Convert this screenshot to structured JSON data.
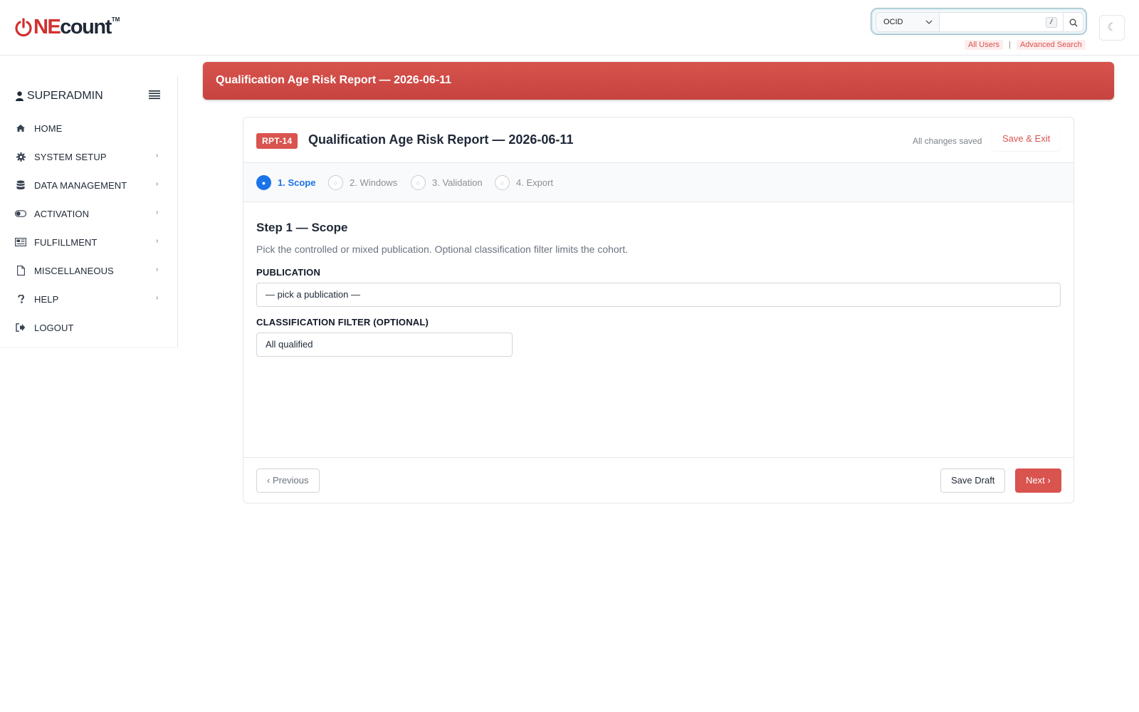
{
  "header": {
    "logo": {
      "one": "NE",
      "count": "count",
      "tm": "TM"
    },
    "search": {
      "field_selected": "OCID",
      "placeholder": "",
      "shortcut_key": "/"
    },
    "quick_links": [
      "All Users",
      "Advanced Search"
    ],
    "quick_link_separator": "|",
    "theme_toggle_glyph": "☾"
  },
  "sidebar": {
    "user": "SUPERADMIN",
    "items": [
      {
        "label": "HOME",
        "icon": "home-icon",
        "has_submenu": false
      },
      {
        "label": "SYSTEM SETUP",
        "icon": "gear-icon",
        "has_submenu": true
      },
      {
        "label": "DATA MANAGEMENT",
        "icon": "database-icon",
        "has_submenu": true
      },
      {
        "label": "ACTIVATION",
        "icon": "toggle-icon",
        "has_submenu": true
      },
      {
        "label": "FULFILLMENT",
        "icon": "newspaper-icon",
        "has_submenu": true
      },
      {
        "label": "MISCELLANEOUS",
        "icon": "file-icon",
        "has_submenu": true
      },
      {
        "label": "HELP",
        "icon": "question-icon",
        "has_submenu": true
      },
      {
        "label": "LOGOUT",
        "icon": "logout-icon",
        "has_submenu": false
      }
    ],
    "submenu_arrow": "›"
  },
  "banner": {
    "title": "Qualification Age Risk Report — 2026-06-11"
  },
  "wizard": {
    "badge": "RPT-14",
    "title": "Qualification Age Risk Report — 2026-06-11",
    "save_status": "All changes saved",
    "save_exit_label": "Save & Exit",
    "steps": [
      {
        "label": "1. Scope",
        "marker": "●",
        "active": true
      },
      {
        "label": "2. Windows",
        "marker": "○",
        "active": false
      },
      {
        "label": "3. Validation",
        "marker": "○",
        "active": false
      },
      {
        "label": "4. Export",
        "marker": "○",
        "active": false
      }
    ],
    "step_heading": "Step 1 — Scope",
    "step_description": "Pick the controlled or mixed publication. Optional classification filter limits the cohort.",
    "fields": {
      "publication": {
        "label": "PUBLICATION",
        "value": "— pick a publication —"
      },
      "classification": {
        "label": "CLASSIFICATION FILTER (OPTIONAL)",
        "value": "All qualified"
      }
    },
    "footer": {
      "previous_label": "‹ Previous",
      "save_draft_label": "Save Draft",
      "next_label": "Next ›"
    }
  },
  "colors": {
    "brand_red": "#d9534f",
    "active_step_blue": "#1a73e8"
  }
}
